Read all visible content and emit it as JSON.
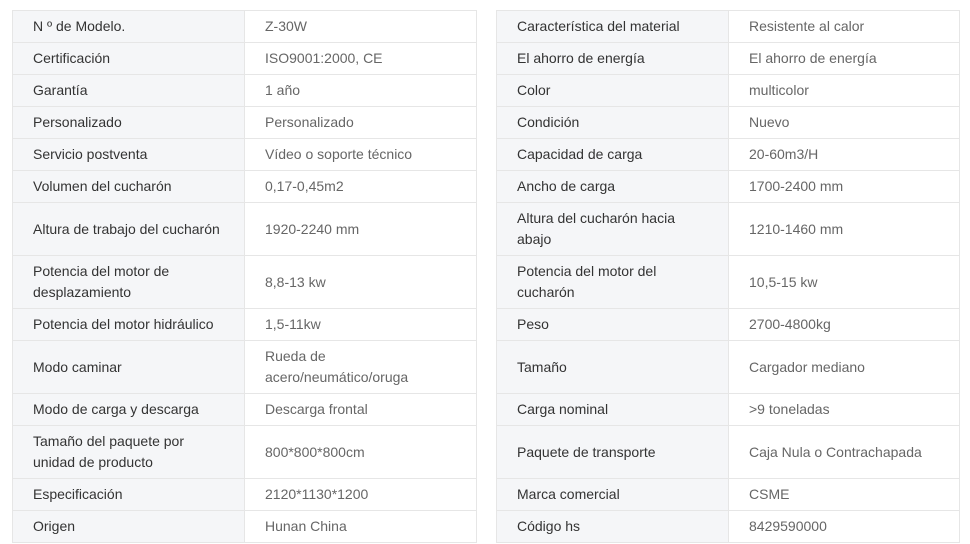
{
  "left_table": [
    {
      "key": "N º de Modelo.",
      "value": "Z-30W"
    },
    {
      "key": "Certificación",
      "value": "ISO9001:2000, CE"
    },
    {
      "key": "Garantía",
      "value": "1 año"
    },
    {
      "key": "Personalizado",
      "value": "Personalizado"
    },
    {
      "key": "Servicio postventa",
      "value": "Vídeo o soporte técnico"
    },
    {
      "key": "Volumen del cucharón",
      "value": "0,17-0,45m2"
    },
    {
      "key": "Altura de trabajo del cucharón",
      "value": "1920-2240 mm"
    },
    {
      "key": "Potencia del motor de desplazamiento",
      "value": "8,8-13 kw"
    },
    {
      "key": "Potencia del motor hidráulico",
      "value": "1,5-11kw"
    },
    {
      "key": "Modo caminar",
      "value": "Rueda de acero/neumático/oruga"
    },
    {
      "key": "Modo de carga y descarga",
      "value": "Descarga frontal"
    },
    {
      "key": "Tamaño del paquete por unidad de producto",
      "value": "800*800*800cm"
    },
    {
      "key": "Especificación",
      "value": "2120*1130*1200"
    },
    {
      "key": "Origen",
      "value": "Hunan China"
    }
  ],
  "right_table": [
    {
      "key": "Característica del material",
      "value": "Resistente al calor"
    },
    {
      "key": "El ahorro de energía",
      "value": "El ahorro de energía"
    },
    {
      "key": "Color",
      "value": "multicolor"
    },
    {
      "key": "Condición",
      "value": "Nuevo"
    },
    {
      "key": "Capacidad de carga",
      "value": "20-60m3/H"
    },
    {
      "key": "Ancho de carga",
      "value": "1700-2400 mm"
    },
    {
      "key": "Altura del cucharón hacia abajo",
      "value": "1210-1460 mm"
    },
    {
      "key": "Potencia del motor del cucharón",
      "value": "10,5-15 kw"
    },
    {
      "key": "Peso",
      "value": "2700-4800kg"
    },
    {
      "key": "Tamaño",
      "value": "Cargador mediano"
    },
    {
      "key": "Carga nominal",
      "value": ">9 toneladas"
    },
    {
      "key": "Paquete de transporte",
      "value": "Caja Nula o Contrachapada"
    },
    {
      "key": "Marca comercial",
      "value": "CSME"
    },
    {
      "key": "Código hs",
      "value": "8429590000"
    }
  ]
}
